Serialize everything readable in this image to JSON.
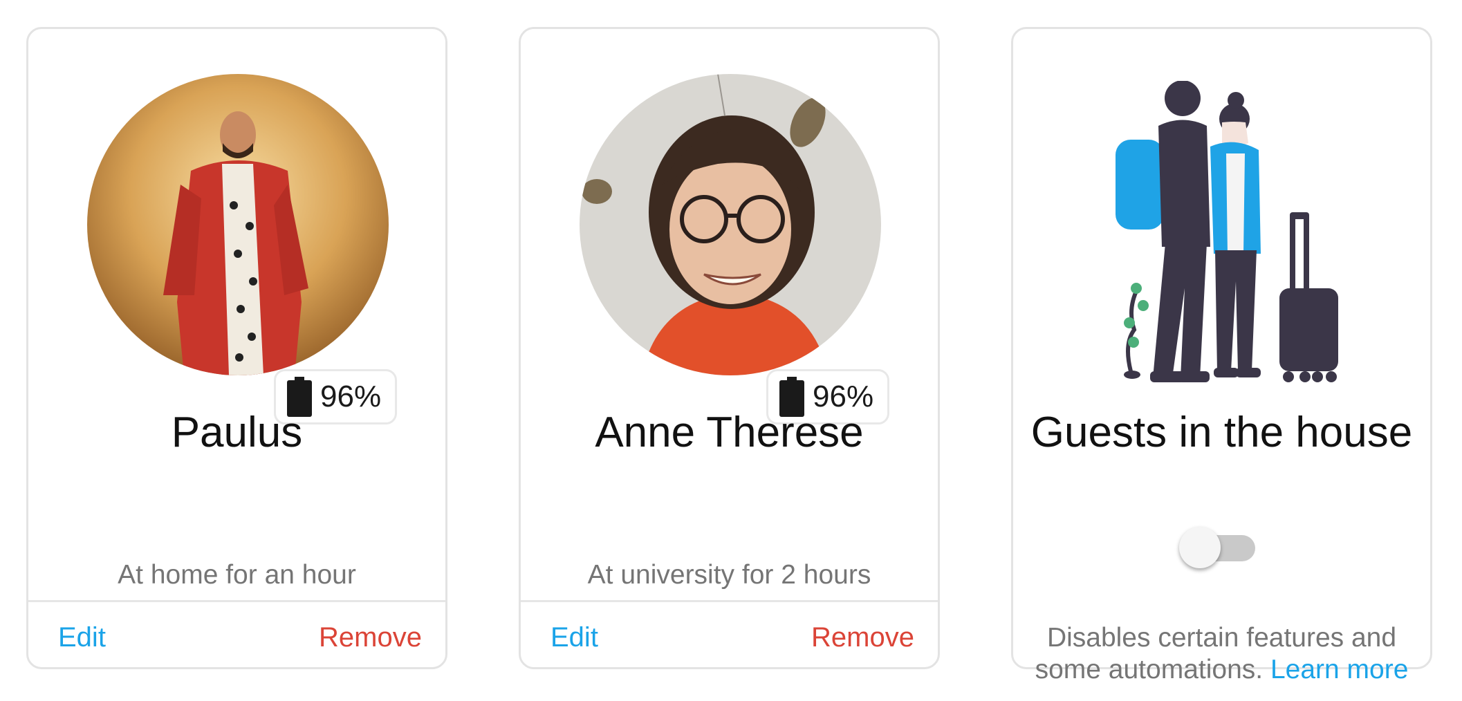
{
  "people": [
    {
      "name": "Paulus",
      "battery": "96%",
      "status": "At home for an hour",
      "edit_label": "Edit",
      "remove_label": "Remove"
    },
    {
      "name": "Anne Therese",
      "battery": "96%",
      "status": "At university for 2 hours",
      "edit_label": "Edit",
      "remove_label": "Remove"
    }
  ],
  "guests": {
    "title": "Guests in the house",
    "toggle_on": false,
    "description_line1": "Disables certain features and",
    "description_line2": "some automations.",
    "learn_more_label": "Learn more"
  },
  "colors": {
    "link_blue": "#1aa3e8",
    "remove_red": "#db4437",
    "muted_text": "#757575",
    "border": "#e3e3e3",
    "illustration_dark": "#3b3648",
    "illustration_accent": "#1fa3e6"
  },
  "icons": {
    "battery": "battery-full-icon",
    "illustration": "guests-travel-illustration"
  }
}
